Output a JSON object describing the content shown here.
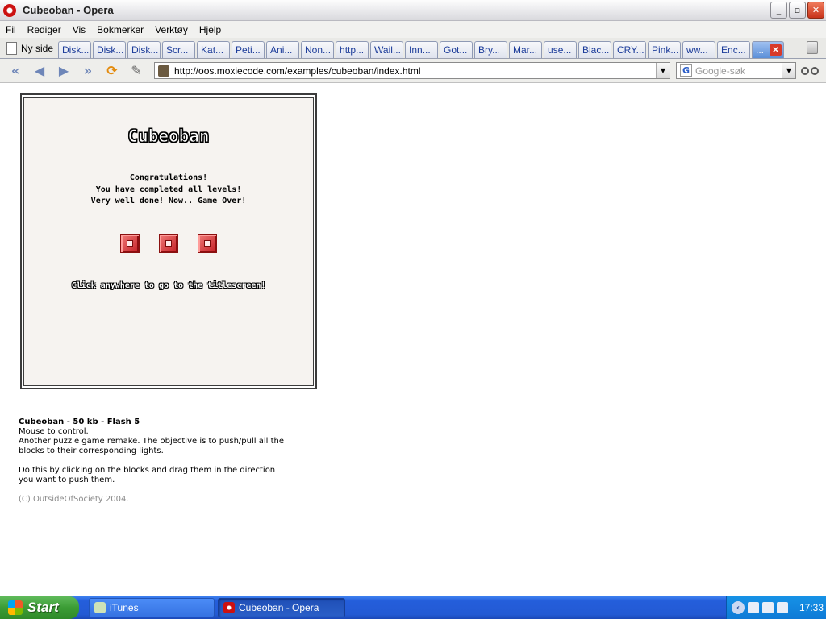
{
  "window": {
    "title": "Cubeoban - Opera",
    "controls": [
      "_",
      "▫",
      "✕"
    ]
  },
  "menu": [
    "Fil",
    "Rediger",
    "Vis",
    "Bokmerker",
    "Verktøy",
    "Hjelp"
  ],
  "tabs": {
    "new_tab_label": "Ny side",
    "items": [
      "Disk...",
      "Disk...",
      "Disk...",
      "Scr...",
      "Kat...",
      "Peti...",
      "Ani...",
      "Non...",
      "http...",
      "Wail...",
      "Inn...",
      "Got...",
      "Bry...",
      "Mar...",
      "use...",
      "Blac...",
      "CRY...",
      "Pink...",
      "ww...",
      "Enc..."
    ],
    "active_label": "..."
  },
  "nav": {
    "url": "http://oos.moxiecode.com/examples/cubeoban/index.html",
    "search_placeholder": "Google-søk",
    "search_engine_letter": "G"
  },
  "game": {
    "title": "Cubeoban",
    "line1": "Congratulations!",
    "line2": "You have completed all levels!",
    "line3": "Very well done! Now.. Game Over!",
    "click_text": "Click anywhere to go to the titlescreen!"
  },
  "description": {
    "title": "Cubeoban - 50 kb - Flash 5",
    "line1": "Mouse to control.",
    "line2": "Another puzzle game remake. The objective is to push/pull all the",
    "line3": "blocks to their corresponding lights.",
    "line4": "Do this by clicking on the blocks and drag them in the direction",
    "line5": "you want to push them.",
    "copyright": "(C) OutsideOfSociety 2004."
  },
  "taskbar": {
    "start": "Start",
    "task1": "iTunes",
    "task2": "Cubeoban - Opera",
    "clock": "17:33"
  },
  "colors": {
    "titlebar": "#e7e7ea",
    "taskbar": "#245edb",
    "start_green": "#3b9c35",
    "block_red": "#c42026",
    "game_bg": "#f6f3f0"
  }
}
